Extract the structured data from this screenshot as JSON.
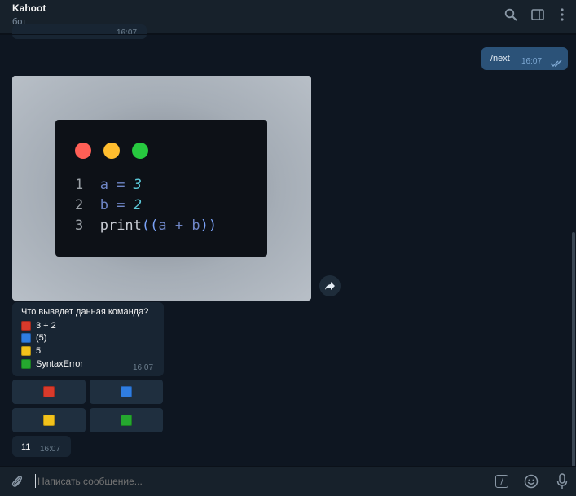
{
  "header": {
    "title": "Kahoot",
    "subtitle": "бот"
  },
  "top_partial": {
    "time": "16:07"
  },
  "outgoing": {
    "text": "/next",
    "time": "16:07"
  },
  "code_image": {
    "lines": [
      {
        "no": "1",
        "parts": [
          [
            "var",
            "a"
          ],
          [
            "var",
            " = "
          ],
          [
            "num",
            "3"
          ]
        ]
      },
      {
        "no": "2",
        "parts": [
          [
            "var",
            "b"
          ],
          [
            "var",
            " = "
          ],
          [
            "num",
            "2"
          ]
        ]
      },
      {
        "no": "3",
        "parts": [
          [
            "fn",
            "print"
          ],
          [
            "par",
            "(("
          ],
          [
            "var",
            "a + b"
          ],
          [
            "par",
            "))"
          ]
        ]
      }
    ],
    "dot_colors": [
      "#ff5f56",
      "#ffbd2e",
      "#27c93f"
    ]
  },
  "quiz": {
    "question": "Что выведет данная команда?",
    "options": [
      {
        "color": "red",
        "text": "3 + 2"
      },
      {
        "color": "blue",
        "text": "(5)"
      },
      {
        "color": "yellow",
        "text": "5"
      },
      {
        "color": "green",
        "text": "SyntaxError"
      }
    ],
    "time": "16:07"
  },
  "keyboard": [
    "red",
    "blue",
    "yellow",
    "green"
  ],
  "last_message": {
    "text": "11",
    "time": "16:07"
  },
  "composer": {
    "placeholder": "Написать сообщение..."
  },
  "colors": {
    "red": "#d93a2b",
    "blue": "#2f7de1",
    "yellow": "#f2c21b",
    "green": "#25a82f",
    "accent": "#2b5278"
  }
}
